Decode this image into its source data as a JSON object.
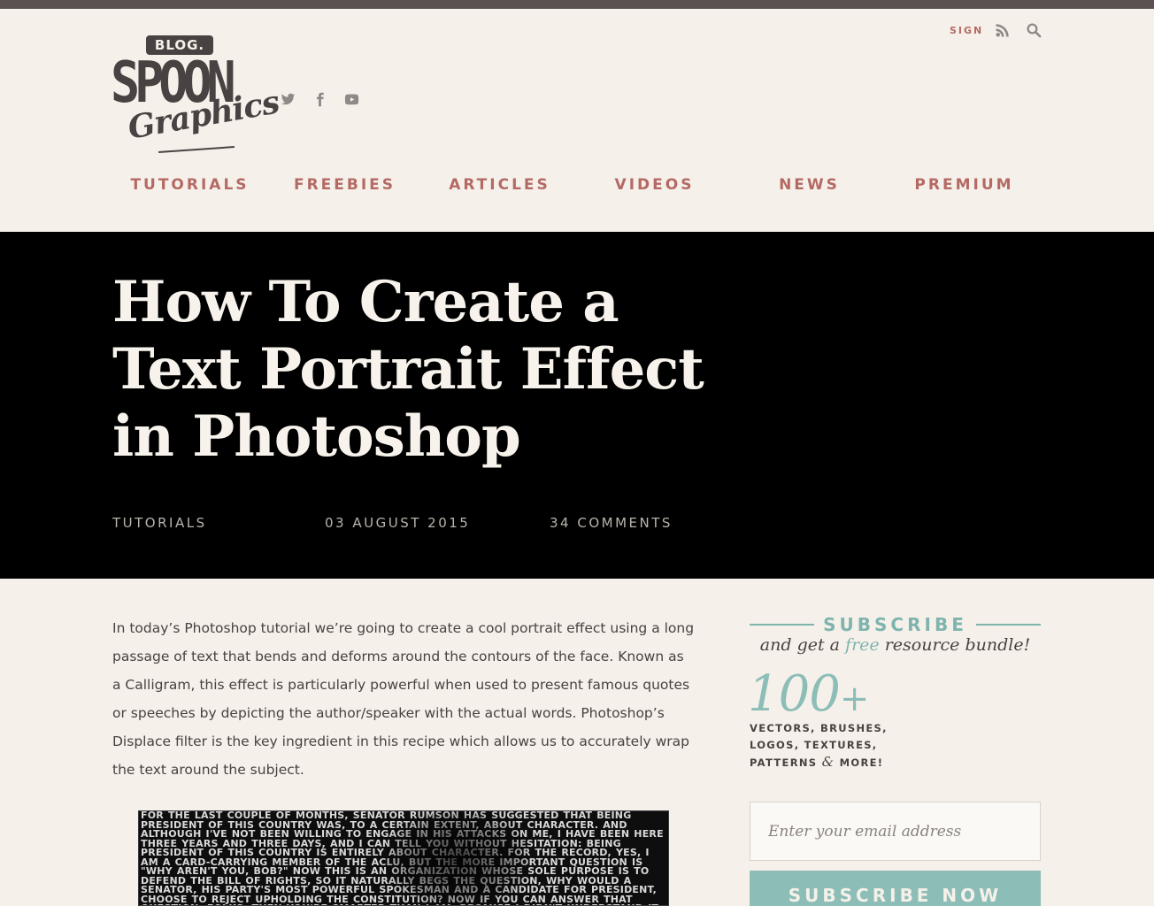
{
  "header": {
    "logo": {
      "top": "BLOG.",
      "main": "SPOON",
      "script": "Graphics"
    },
    "top_links": {
      "sign": "SIGN"
    },
    "social_icons": [
      "twitter-icon",
      "facebook-icon",
      "youtube-icon"
    ],
    "nav": [
      "TUTORIALS",
      "FREEBIES",
      "ARTICLES",
      "VIDEOS",
      "NEWS",
      "PREMIUM"
    ]
  },
  "hero": {
    "title": "How To Create a Text Portrait Effect in Photoshop",
    "category": "TUTORIALS",
    "date": "03 AUGUST 2015",
    "comments": "34 COMMENTS"
  },
  "article": {
    "intro": "In today’s Photoshop tutorial we’re going to create a cool portrait effect using a long passage of text that bends and deforms around the contours of the face. Known as a Calligram, this effect is particularly powerful when used to present famous quotes or speeches by depicting the author/speaker with the actual words. Photoshop’s Displace filter is the key ingredient in this recipe which allows us to accurately wrap the text around the subject.",
    "image_text": "For the last couple of months, Senator Rumson has suggested that being President of this country was, to a certain extent, about character. And although I've not been willing to engage in his attacks on me, I have been here three years and three days, and I can tell you without hesitation: being President of this country is entirely about character. For the record, yes, I am a card-carrying member of the ACLU, but the more important question is \"Why aren't you, Bob?\" Now this is an organization whose sole purpose is to defend the Bill of Rights, so it naturally begs the question, why would a senator, his party's most powerful spokesman and a candidate for president, choose to reject upholding the Constitution? Now if you can answer that question, folks, then you're smarter than I am, because I didn't understand it until a few hours ago. America isn't easy. America is advanced citizenship. You've gotta want it bad, 'cause it's gonna put"
  },
  "sidebar": {
    "subscribe_title": "SUBSCRIBE",
    "tagline_pre": "and get a",
    "tagline_free": "free",
    "tagline_post": "resource bundle!",
    "count": "100",
    "count_suffix": "+",
    "resources_line1": "VECTORS, BRUSHES,",
    "resources_line2": "LOGOS, TEXTURES,",
    "resources_line3_pre": "PATTERNS",
    "resources_line3_amp": "&",
    "resources_line3_post": "MORE!",
    "email_placeholder": "Enter your email address",
    "button_label": "SUBSCRIBE NOW"
  },
  "colors": {
    "background": "#f5f1ea",
    "accent_red": "#b56964",
    "accent_teal": "#8cbdb6",
    "hero_bg": "#000000",
    "topbar": "#5c5151"
  }
}
